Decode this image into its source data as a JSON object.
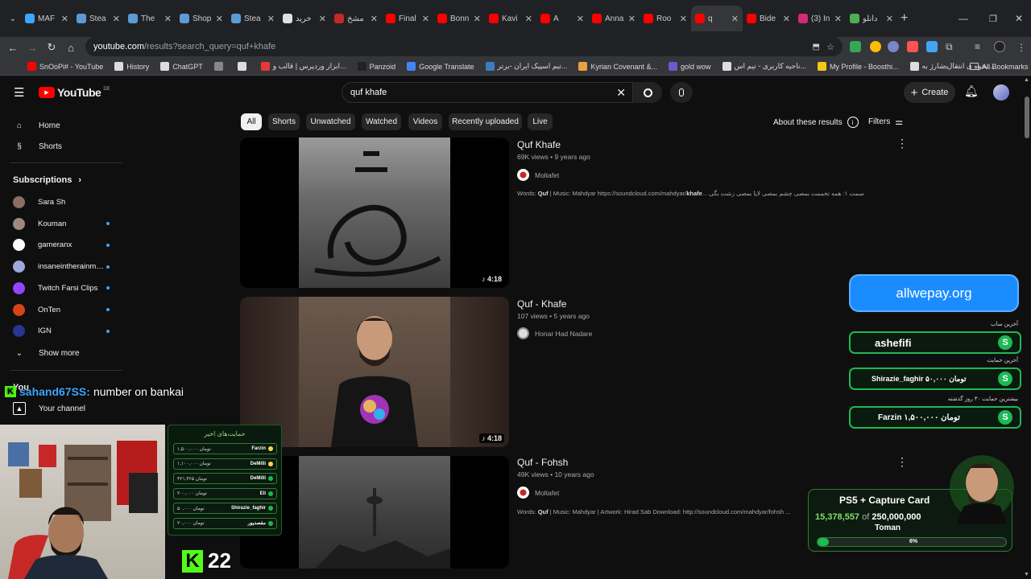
{
  "browser": {
    "tabs": [
      {
        "label": "MAF",
        "color": "#3ea6ff"
      },
      {
        "label": "Stea",
        "color": "#5b9bd5"
      },
      {
        "label": "The",
        "color": "#5b9bd5"
      },
      {
        "label": "Shop",
        "color": "#5b9bd5"
      },
      {
        "label": "Stea",
        "color": "#5b9bd5"
      },
      {
        "label": "خرید",
        "color": "#e0e0e0"
      },
      {
        "label": "مشخ",
        "color": "#c62828"
      },
      {
        "label": "Final",
        "color": "#ff0000"
      },
      {
        "label": "Bonn",
        "color": "#ff0000"
      },
      {
        "label": "Kavi",
        "color": "#ff0000"
      },
      {
        "label": "A",
        "color": "#ff0000"
      },
      {
        "label": "Anna",
        "color": "#ff0000"
      },
      {
        "label": "Roo",
        "color": "#ff0000"
      },
      {
        "label": "q",
        "color": "#ff0000",
        "active": true
      },
      {
        "label": "Bide",
        "color": "#ff0000"
      },
      {
        "label": "(3) In",
        "color": "#d62976"
      },
      {
        "label": "دانلو",
        "color": "#4caf50"
      }
    ],
    "url_host": "youtube.com",
    "url_path": "/results?search_query=quf+khafe",
    "bookmarks": [
      {
        "label": "SnOoPi# - YouTube",
        "color": "#ff0000"
      },
      {
        "label": "History",
        "color": "#ddd"
      },
      {
        "label": "ChatGPT",
        "color": "#ddd"
      },
      {
        "label": "",
        "color": "#888"
      },
      {
        "label": "",
        "color": "#ddd"
      },
      {
        "label": "ابزار وردپرس | قالب و...",
        "color": "#e53935"
      },
      {
        "label": "Panzoid",
        "color": "#222"
      },
      {
        "label": "Google Translate",
        "color": "#4285f4"
      },
      {
        "label": "تیم اسپیک ایران -برتر...",
        "color": "#3e7cc2"
      },
      {
        "label": "Kyrian Covenant &...",
        "color": "#e8a33d"
      },
      {
        "label": "gold wow",
        "color": "#6a5acd"
      },
      {
        "label": "ناحیه کاربری - تیم اس...",
        "color": "#ddd"
      },
      {
        "label": "My Profile - Boosthi...",
        "color": "#f5c518"
      },
      {
        "label": "نحوه ی انتقال شارژ به...",
        "color": "#ddd"
      }
    ],
    "all_bookmarks": "All Bookmarks"
  },
  "youtube": {
    "logo": "YouTube",
    "region": "DE",
    "search_value": "quf khafe",
    "create_label": "Create",
    "nav": [
      {
        "label": "Home",
        "icon": "home-icon"
      },
      {
        "label": "Shorts",
        "icon": "shorts-icon"
      }
    ],
    "subscriptions_title": "Subscriptions",
    "subscriptions": [
      {
        "name": "Sara Sh",
        "color": "#8d6e63",
        "dot": false
      },
      {
        "name": "Kouman",
        "color": "#a1887f",
        "dot": true
      },
      {
        "name": "gameranx",
        "color": "#ffffff",
        "dot": true
      },
      {
        "name": "insaneintherainmus...",
        "color": "#9fa8da",
        "dot": true
      },
      {
        "name": "Twitch Farsi Clips",
        "color": "#9146ff",
        "dot": true
      },
      {
        "name": "OnTen",
        "color": "#d84315",
        "dot": true
      },
      {
        "name": "IGN",
        "color": "#283593",
        "dot": true
      }
    ],
    "show_more": "Show more",
    "you_label": "You",
    "your_channel": "Your channel",
    "chips": [
      "All",
      "Shorts",
      "Unwatched",
      "Watched",
      "Videos",
      "Recently uploaded",
      "Live"
    ],
    "about_results": "About these results",
    "filters": "Filters",
    "videos": [
      {
        "title": "Quf Khafe",
        "meta": "69K views • 9 years ago",
        "channel": "Moltafet",
        "desc_prefix": "Words: ",
        "desc_b1": "Quf",
        "desc_mid": " | Music: Mahdyar https://soundcloud.com/mahdyar/",
        "desc_b2": "khafe",
        "desc_rest": "... قسمت ۱: همه تخممت بمصی چشم بمصی لاپا بمصی زشت بگی",
        "duration": "4:18"
      },
      {
        "title": "Quf - Khafe",
        "meta": "107 views • 5 years ago",
        "channel": "Honar Had Nadare",
        "duration": "4:18"
      },
      {
        "title": "Quf - Fohsh",
        "meta": "49K views • 10 years ago",
        "channel": "Moltafet",
        "desc_prefix": "Words: ",
        "desc_b1": "Quf",
        "desc_rest": " | Music: Mahdyar | Artwork: Hirad Sab Download: http://soundcloud.com/mahdyar/fohsh ..."
      }
    ]
  },
  "overlay": {
    "chat_user": "sahand67SS:",
    "chat_msg": "number on bankai",
    "donation_site": "allwepay.org",
    "last_sub_label": "آخرین ساب",
    "last_sub": "ashefifi",
    "last_donation_label": "آخرین حمایت",
    "last_donation": "Shirazie_faghir  ۵۰,۰۰۰ تومان",
    "top_donation_label": "بیشترین حمایت ۳۰ روز گذشته",
    "top_donation": "Farzin  ۱,۵۰۰,۰۰۰ تومان",
    "recent_title": "حمایت‌های اخیر",
    "recent": [
      {
        "name": "Farzin",
        "amount": "۱,۵۰۰,۰۰۰ تومان",
        "color": "#ffd54f"
      },
      {
        "name": "DeMilli",
        "amount": "۱,۱۰۰,۰۰۰ تومان",
        "color": "#ffd54f"
      },
      {
        "name": "DeMilli",
        "amount": "۴۲۱,۳۶۵ تومان",
        "color": "#1db954"
      },
      {
        "name": "Eli",
        "amount": "۲۰۰,۰۰۰ تومان",
        "color": "#1db954"
      },
      {
        "name": "Shirazie_faghir",
        "amount": "۵۰,۰۰۰ تومان",
        "color": "#1db954"
      },
      {
        "name": "مقصدپور",
        "amount": "۲۰,۰۰۰ تومان",
        "color": "#1db954"
      }
    ],
    "kick_count": "22",
    "goal_title": "PS5 + Capture Card",
    "goal_raised": "15,378,557",
    "goal_of": "of",
    "goal_target": "250,000,000",
    "goal_unit": "Toman",
    "goal_percent_label": "6%",
    "goal_percent": 6,
    "accent": "#1db954"
  }
}
